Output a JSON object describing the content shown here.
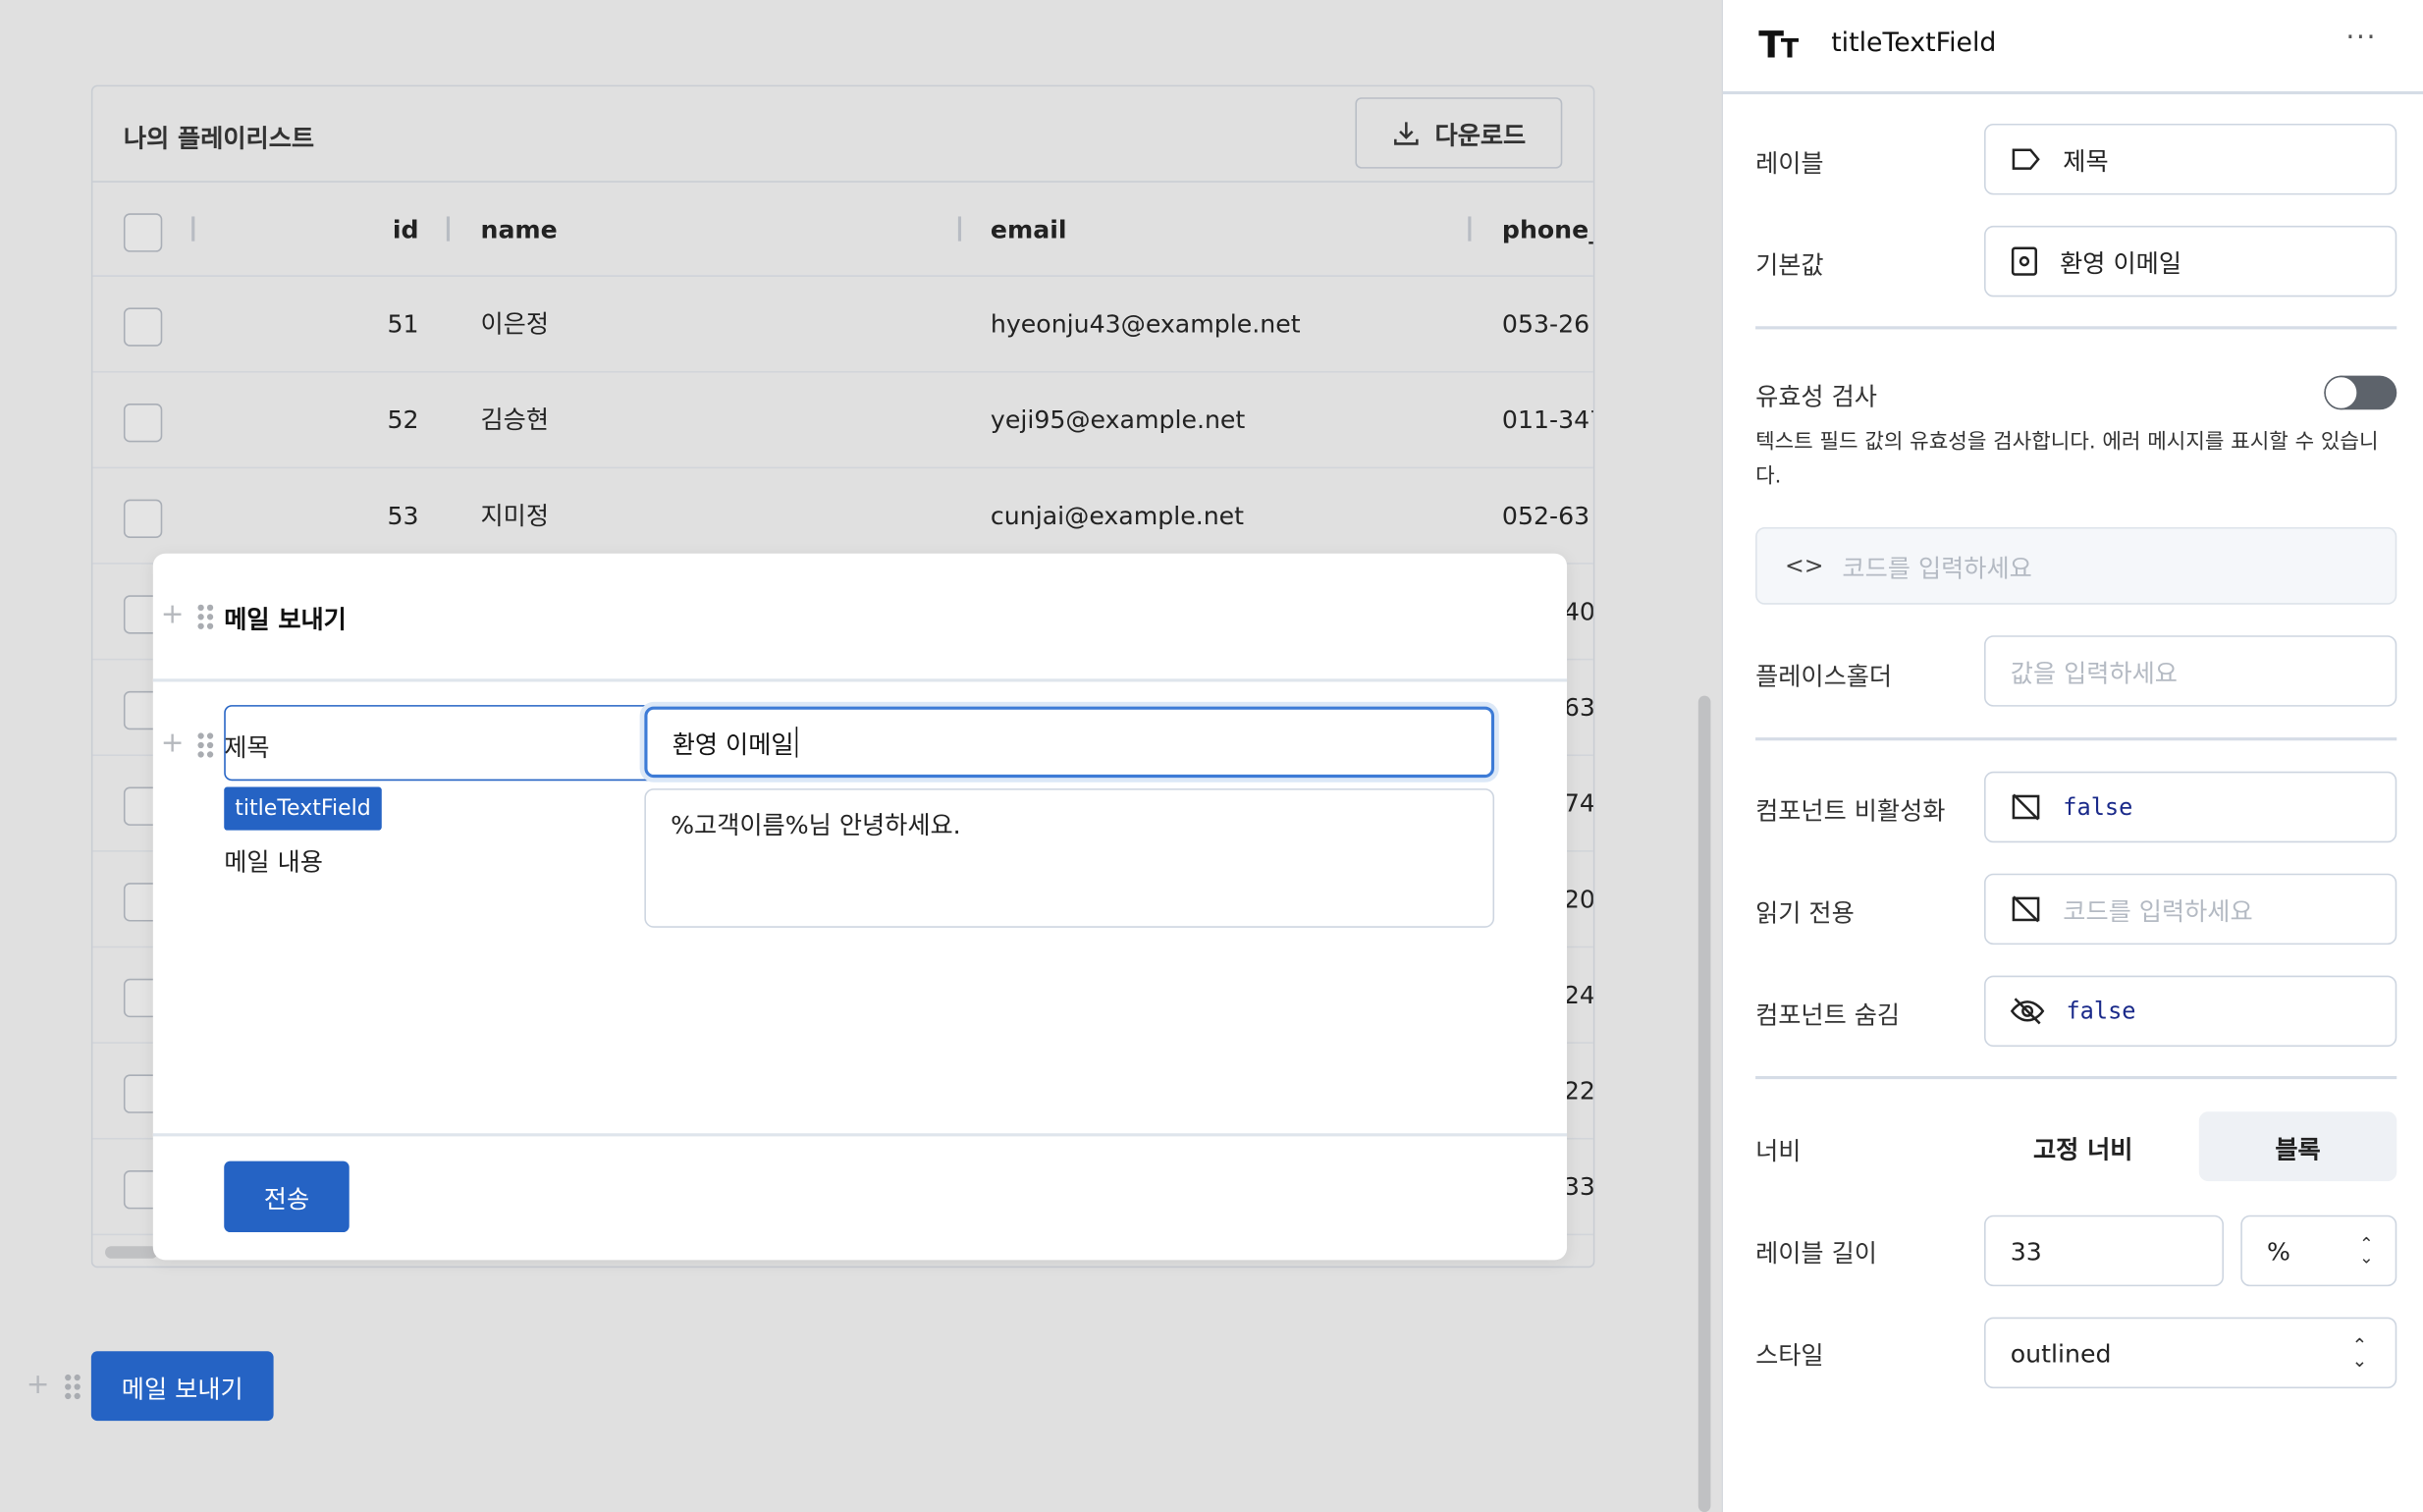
{
  "table": {
    "title": "나의 플레이리스트",
    "download_label": "다운로드",
    "columns": [
      "id",
      "name",
      "email",
      "phone_"
    ],
    "rows": [
      {
        "id": "51",
        "name": "이은정",
        "email": "hyeonju43@example.net",
        "phone": "053-26"
      },
      {
        "id": "52",
        "name": "김승현",
        "email": "yeji95@example.net",
        "phone": "011-347"
      },
      {
        "id": "53",
        "name": "지미정",
        "email": "cunjai@example.net",
        "phone": "052-63"
      }
    ],
    "partial_phones": [
      "40",
      "63",
      "74(",
      "20",
      "24",
      "22",
      "33"
    ]
  },
  "modal": {
    "title": "메일 보내기",
    "subject_label": "제목",
    "subject_value": "환영 이메일",
    "component_tag": "titleTextField",
    "body_label": "메일 내용",
    "body_value": "%고객이름%님 안녕하세요.",
    "submit_label": "전송"
  },
  "canvas_button_label": "메일 보내기",
  "panel": {
    "component_name": "titleTextField",
    "label_label": "레이블",
    "label_value": "제목",
    "default_label": "기본값",
    "default_value": "환영 이메일",
    "validation_label": "유효성 검사",
    "validation_enabled": false,
    "validation_desc": "텍스트 필드 값의 유효성을 검사합니다. 에러 메시지를 표시할 수 있습니다.",
    "code_placeholder": "코드를 입력하세요",
    "placeholder_label": "플레이스홀더",
    "placeholder_placeholder": "값을 입력하세요",
    "disabled_label": "컴포넌트 비활성화",
    "disabled_value": "false",
    "readonly_label": "읽기 전용",
    "readonly_placeholder": "코드를 입력하세요",
    "hidden_label": "컴포넌트 숨김",
    "hidden_value": "false",
    "width_label": "너비",
    "width_options": [
      "고정 너비",
      "블록"
    ],
    "width_selected": "블록",
    "label_length_label": "레이블 길이",
    "label_length_value": "33",
    "label_length_unit": "%",
    "style_label": "스타일",
    "style_value": "outlined"
  },
  "colors": {
    "primary": "#2563c4",
    "canvas": "#e0e0e0",
    "toggle_off": "#5d636b"
  }
}
